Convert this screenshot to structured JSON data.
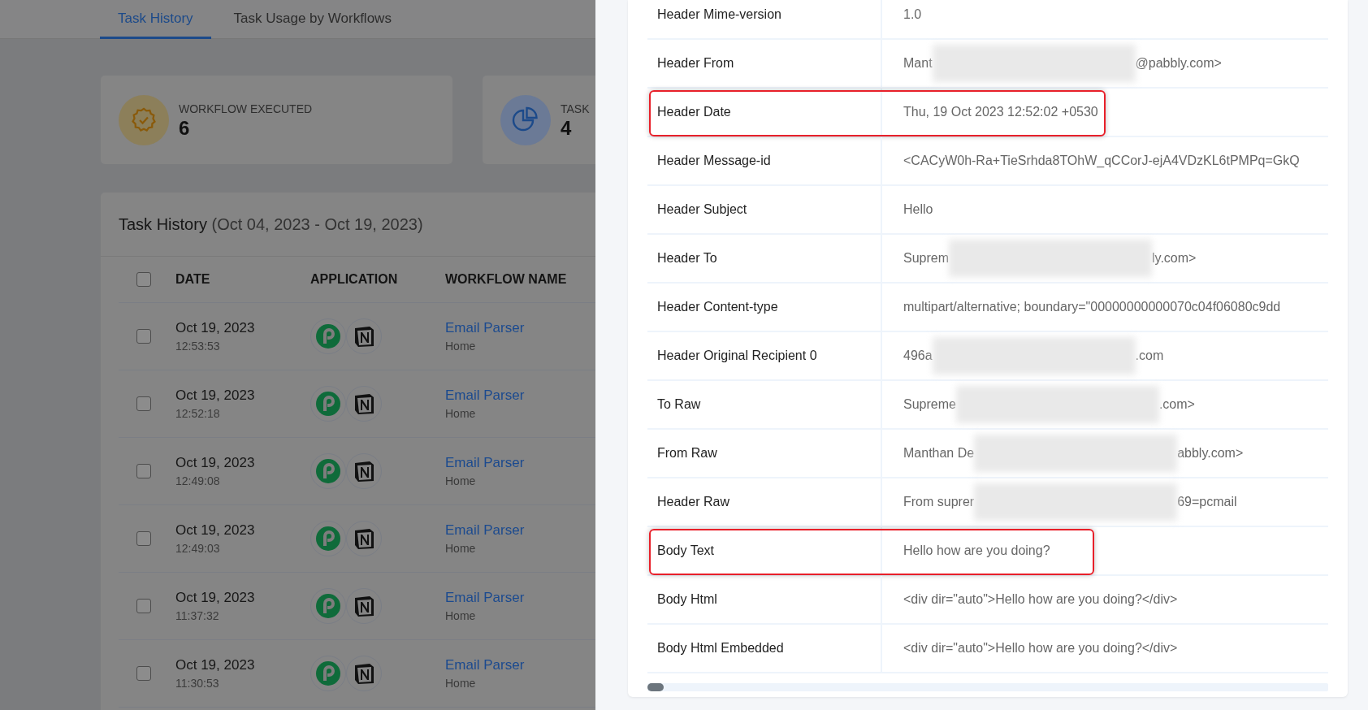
{
  "tabs": [
    {
      "label": "Task History",
      "selected": true
    },
    {
      "label": "Task Usage by Workflows",
      "selected": false
    }
  ],
  "stats": [
    {
      "kind": "badge",
      "label": "WORKFLOW EXECUTED",
      "value": "6"
    },
    {
      "kind": "pie",
      "label": "TASK",
      "value": "4"
    }
  ],
  "task_history": {
    "title": "Task History",
    "range": "(Oct 04, 2023 - Oct 19, 2023)",
    "select_all_checked": false,
    "columns": [
      "DATE",
      "APPLICATION",
      "WORKFLOW NAME"
    ],
    "rows": [
      {
        "checked": false,
        "date": "Oct 19, 2023",
        "time": "12:53:53",
        "workflow": "Email Parser",
        "folder": "Home"
      },
      {
        "checked": false,
        "date": "Oct 19, 2023",
        "time": "12:52:18",
        "workflow": "Email Parser",
        "folder": "Home"
      },
      {
        "checked": false,
        "date": "Oct 19, 2023",
        "time": "12:49:08",
        "workflow": "Email Parser",
        "folder": "Home"
      },
      {
        "checked": false,
        "date": "Oct 19, 2023",
        "time": "12:49:03",
        "workflow": "Email Parser",
        "folder": "Home"
      },
      {
        "checked": false,
        "date": "Oct 19, 2023",
        "time": "11:37:32",
        "workflow": "Email Parser",
        "folder": "Home"
      },
      {
        "checked": false,
        "date": "Oct 19, 2023",
        "time": "11:30:53",
        "workflow": "Email Parser",
        "folder": "Home"
      }
    ]
  },
  "details": {
    "rows": [
      {
        "label": "Header Mime-version",
        "value": "1.0",
        "redacted": false,
        "highlighted": false
      },
      {
        "label": "Header From",
        "value": "Mant",
        "value_end": "@pabbly.com>",
        "redacted": true,
        "highlighted": false
      },
      {
        "label": "Header Date",
        "value": "Thu, 19 Oct 2023 12:52:02 +0530",
        "redacted": false,
        "highlighted": true
      },
      {
        "label": "Header Message-id",
        "value": "<CACyW0h-Ra+TieSrhda8TOhW_qCCorJ-ejA4VDzKL6tPMPq=GkQ",
        "redacted": false,
        "highlighted": false
      },
      {
        "label": "Header Subject",
        "value": "Hello",
        "redacted": false,
        "highlighted": false
      },
      {
        "label": "Header To",
        "value": "Suprem",
        "value_end": "ly.com>",
        "redacted": true,
        "highlighted": false
      },
      {
        "label": "Header Content-type",
        "value": "multipart/alternative; boundary=\"00000000000070c04f06080c9dd",
        "redacted": false,
        "highlighted": false
      },
      {
        "label": "Header Original Recipient 0",
        "value": "496a",
        "value_end": ".com",
        "redacted": true,
        "highlighted": false
      },
      {
        "label": "To Raw",
        "value": "Supreme",
        "value_end": ".com>",
        "redacted": true,
        "highlighted": false
      },
      {
        "label": "From Raw",
        "value": "Manthan De",
        "value_end": "abbly.com>",
        "redacted": true,
        "highlighted": false
      },
      {
        "label": "Header Raw",
        "value": "From suprer",
        "value_end": "69=pcmail",
        "redacted": true,
        "highlighted": false
      },
      {
        "label": "Body Text",
        "value": "Hello how are you doing?",
        "redacted": false,
        "highlighted": true
      },
      {
        "label": "Body Html",
        "value": "<div dir=\"auto\">Hello how are you doing?</div>",
        "redacted": false,
        "highlighted": false
      },
      {
        "label": "Body Html Embedded",
        "value": "<div dir=\"auto\">Hello how are you doing?</div>",
        "redacted": false,
        "highlighted": false
      }
    ]
  }
}
